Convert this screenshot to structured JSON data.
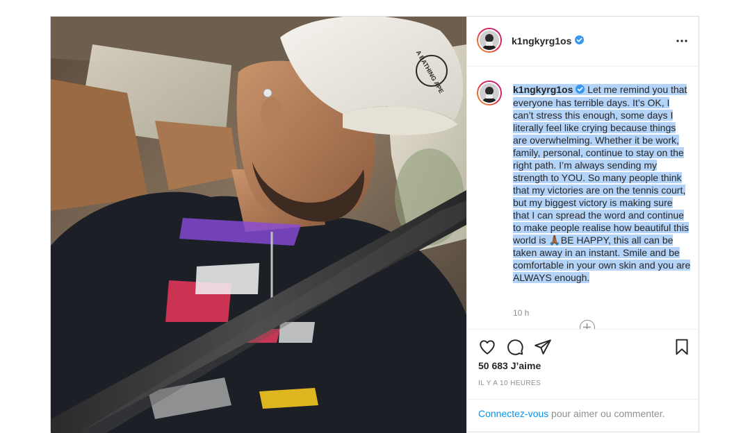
{
  "post": {
    "username": "k1ngkyrg1os",
    "verified": true,
    "photo_alt": "Selfie d'un homme portant une casquette blanche A Bathing Ape et un sweat noir dans une voiture",
    "cap_logo_text": "A BATHING APE"
  },
  "caption": {
    "username": "k1ngkyrg1os",
    "text_before_emoji": "Let me remind you that everyone has terrible days. It’s OK, I can’t stress this enough, some days I literally feel like crying because things are overwhelming. Whether it be work, family, personal, continue to stay on the right path. I’m always sending my strength to YOU. So many people think that my victories are on the tennis court, but my biggest victory is making sure that I can spread the word and continue to make people realise how beautiful this world is ",
    "emoji": "🙏🏾",
    "text_after_emoji": "BE HAPPY, this all can be taken away in an instant. Smile and be comfortable in your own skin and you are ALWAYS enough.",
    "time": "10 h"
  },
  "actions": {
    "likes": "50 683 J’aime",
    "time_ago": "IL Y A 10 HEURES"
  },
  "footer": {
    "login_link": "Connectez-vous",
    "login_rest": " pour aimer ou commenter."
  },
  "colors": {
    "verified_blue": "#3897f0",
    "selection": "#b4d3f8",
    "link": "#0095f6",
    "muted": "#8e8e8e"
  },
  "icons": {
    "more": "more-icon",
    "like": "heart-icon",
    "comment": "comment-icon",
    "share": "share-icon",
    "save": "bookmark-icon",
    "load_more": "plus-circle-icon"
  }
}
